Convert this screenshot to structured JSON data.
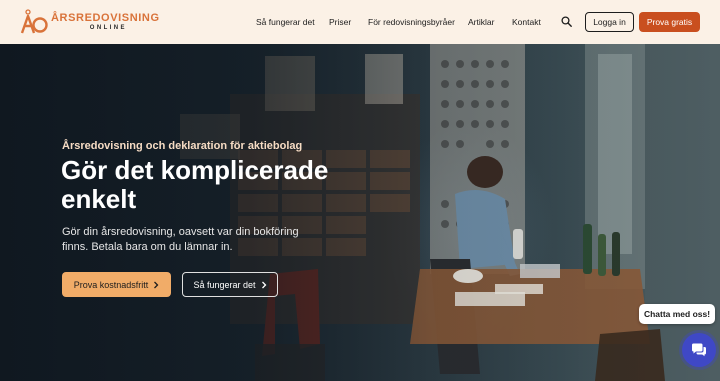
{
  "brand": {
    "name": "ÅRSREDOVISNING",
    "tagline": "ONLINE",
    "accent": "#d9733a"
  },
  "nav": {
    "items": [
      "Så fungerar det",
      "Priser",
      "För redovisningsbyråer",
      "Artiklar",
      "Kontakt"
    ],
    "search_icon": "search-icon",
    "login_label": "Logga in",
    "trial_label": "Prova gratis",
    "trial_color": "#c94f1f"
  },
  "hero": {
    "eyebrow": "Årsredovisning och deklaration för aktiebolag",
    "headline": "Gör det komplicerade enkelt",
    "subtitle": "Gör din årsredovisning, oavsett var din bokföring finns. Betala bara om du lämnar in.",
    "cta_primary": "Prova kostnadsfritt",
    "cta_secondary": "Så fungerar det",
    "cta_primary_color": "#f1ac68"
  },
  "chat": {
    "label": "Chatta med oss!",
    "icon": "chat-icon",
    "color": "#3f48c6"
  }
}
